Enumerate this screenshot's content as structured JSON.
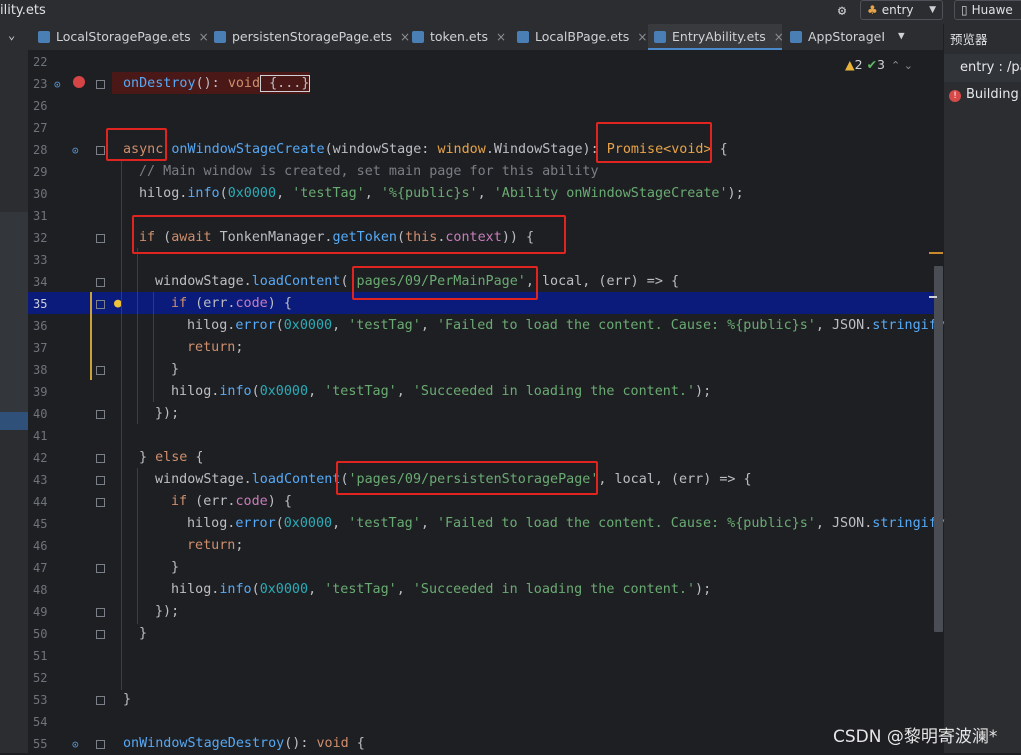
{
  "window": {
    "title": "ility.ets"
  },
  "toolbar": {
    "entry_label": "entry",
    "device_label": "Huawe"
  },
  "tabs": [
    {
      "label": "LocalStoragePage.ets"
    },
    {
      "label": "persistenStoragePage.ets"
    },
    {
      "label": "token.ets"
    },
    {
      "label": "LocalBPage.ets"
    },
    {
      "label": "EntryAbility.ets",
      "active": true
    },
    {
      "label": "AppStorageI"
    }
  ],
  "inspections": {
    "warnings": "2",
    "checks": "3"
  },
  "previewer": {
    "header": "预览器",
    "entry": "entry : /pa",
    "status": "Building"
  },
  "watermark": "CSDN @黎明寄波澜*",
  "lines": [
    "22",
    "23",
    "26",
    "27",
    "28",
    "29",
    "30",
    "31",
    "32",
    "33",
    "34",
    "35",
    "36",
    "37",
    "38",
    "39",
    "40",
    "41",
    "42",
    "43",
    "44",
    "45",
    "46",
    "47",
    "48",
    "49",
    "50",
    "51",
    "52",
    "53",
    "54",
    "55"
  ],
  "code": {
    "l23a": "onDestroy",
    "l23b": "(): ",
    "l23c": "void",
    "l23d": " {...}",
    "l28_async": "async",
    "l28_fn": "onWindowStageCreate",
    "l28_p1": "(windowStage: ",
    "l28_t1": "window",
    "l28_t2": ".WindowStage): ",
    "l28_promise": "Promise<void>",
    "l28_end": " {",
    "l29": "// Main window is created, set main page for this ability",
    "l30a": "hilog.",
    "l30b": "info",
    "l30c": "(",
    "l30d": "0x0000",
    "l30e": ", ",
    "l30f": "'testTag'",
    "l30g": ", ",
    "l30h": "'%{public}s'",
    "l30i": ", ",
    "l30j": "'Ability onWindowStageCreate'",
    "l30k": ");",
    "l32a": "if",
    "l32b": " (",
    "l32c": "await",
    "l32d": " TonkenManager.",
    "l32e": "getToken",
    "l32f": "(",
    "l32g": "this",
    "l32h": ".",
    "l32i": "context",
    "l32j": ")) {",
    "l34a": "windowStage.",
    "l34b": "loadContent",
    "l34c": "(",
    "l34d": "'pages/09/PerMainPage'",
    "l34e": ", local, (err) => {",
    "l35a": "if",
    "l35b": " (err.",
    "l35c": "code",
    "l35d": ") {",
    "l36a": "hilog.",
    "l36b": "error",
    "l36c": "(",
    "l36d": "0x0000",
    "l36e": ", ",
    "l36f": "'testTag'",
    "l36g": ", ",
    "l36h": "'Failed to load the content. Cause: %{public}s'",
    "l36i": ", JSON.",
    "l36j": "stringify",
    "l37": "return",
    "l37b": ";",
    "l38": "}",
    "l39a": "hilog.",
    "l39b": "info",
    "l39c": "(",
    "l39d": "0x0000",
    "l39e": ", ",
    "l39f": "'testTag'",
    "l39g": ", ",
    "l39h": "'Succeeded in loading the content.'",
    "l39i": ");",
    "l40": "});",
    "l42a": "} ",
    "l42b": "else",
    "l42c": " {",
    "l43a": "windowStage.",
    "l43b": "loadContent",
    "l43c": "(",
    "l43d": "'pages/09/persistenStoragePage'",
    "l43e": ", local, (err) => {",
    "l50": "}",
    "l53": "}",
    "l55a": "onWindowStageDestroy",
    "l55b": "(): ",
    "l55c": "void",
    "l55d": " {"
  },
  "colors": {
    "background": "#1e1f22",
    "current_line": "#0a1b7c",
    "annotation_box": "#e0241f"
  }
}
